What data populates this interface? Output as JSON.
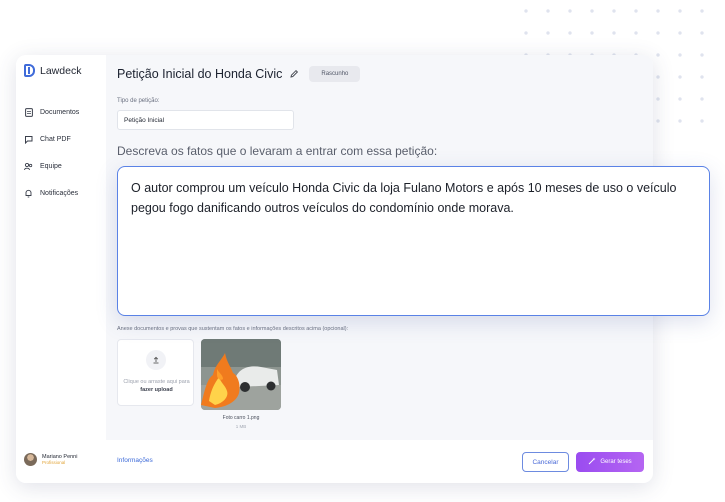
{
  "app": {
    "name": "Lawdeck"
  },
  "sidebar": {
    "items": [
      {
        "label": "Documentos",
        "icon": "document-icon"
      },
      {
        "label": "Chat PDF",
        "icon": "chat-icon"
      },
      {
        "label": "Equipe",
        "icon": "team-icon"
      },
      {
        "label": "Notificações",
        "icon": "bell-icon"
      }
    ],
    "user": {
      "name": "Mariano Penni",
      "role": "Profissional"
    }
  },
  "header": {
    "title": "Petição Inicial do Honda Civic",
    "status_badge": "Rascunho"
  },
  "form": {
    "petition_type_label": "Tipo de petição:",
    "petition_type_value": "Petição Inicial",
    "facts_prompt": "Descreva os fatos que o levaram a entrar com essa petição:",
    "facts_text": "O autor comprou um veículo Honda Civic da loja Fulano Motors e após 10 meses de uso o veículo pegou fogo danificando outros veículos do condomínio onde morava.",
    "attachments_label": "Anexe documentos e provas que sustentam os fatos e informações descritos acima (opcional):",
    "upload_text": "Clique ou arraste aqui para",
    "upload_link": "fazer upload",
    "file": {
      "name": "Foto carro 1.png",
      "size": "1 MB"
    }
  },
  "footer": {
    "info_link": "Informações",
    "cancel_label": "Cancelar",
    "generate_label": "Gerar teses"
  },
  "colors": {
    "accent_blue": "#3f6bd9",
    "accent_purple": "#a855f0"
  }
}
